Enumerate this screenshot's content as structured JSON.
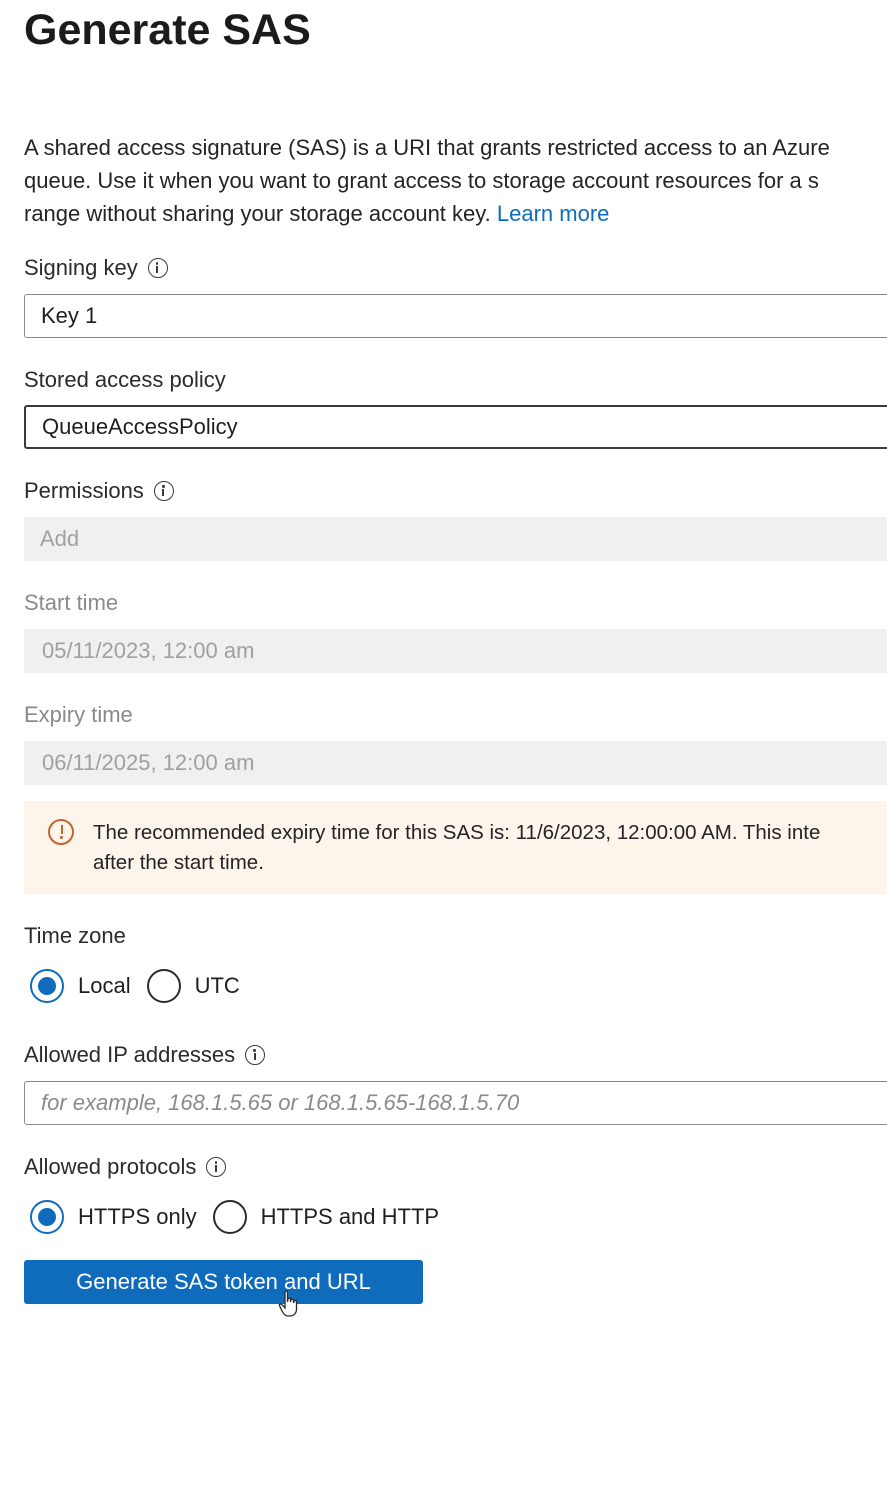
{
  "header": {
    "title": "Generate SAS"
  },
  "description": {
    "line1": "A shared access signature (SAS) is a URI that grants restricted access to an Azure",
    "line2": "queue. Use it when you want to grant access to storage account resources for a s",
    "line3": "range without sharing your storage account key.",
    "learn_more": "Learn more"
  },
  "signing_key": {
    "label": "Signing key",
    "value": "Key 1"
  },
  "stored_access_policy": {
    "label": "Stored access policy",
    "value": "QueueAccessPolicy"
  },
  "permissions": {
    "label": "Permissions",
    "placeholder": "Add"
  },
  "start_time": {
    "label": "Start time",
    "value": "05/11/2023, 12:00 am"
  },
  "expiry_time": {
    "label": "Expiry time",
    "value": "06/11/2025, 12:00 am"
  },
  "warning": {
    "line1": "The recommended expiry time for this SAS is: 11/6/2023, 12:00:00 AM. This inte",
    "line2": "after the start time."
  },
  "time_zone": {
    "label": "Time zone",
    "options": [
      "Local",
      "UTC"
    ],
    "selected": "Local"
  },
  "allowed_ip": {
    "label": "Allowed IP addresses",
    "placeholder": "for example, 168.1.5.65 or 168.1.5.65-168.1.5.70"
  },
  "allowed_protocols": {
    "label": "Allowed protocols",
    "options": [
      "HTTPS only",
      "HTTPS and HTTP"
    ],
    "selected": "HTTPS only"
  },
  "actions": {
    "generate_label": "Generate SAS token and URL"
  },
  "colors": {
    "accent": "#0f6cbd",
    "warning_bg": "#fdf4ec",
    "warning_icon": "#c5642b",
    "disabled_bg": "#f0f0f0"
  }
}
